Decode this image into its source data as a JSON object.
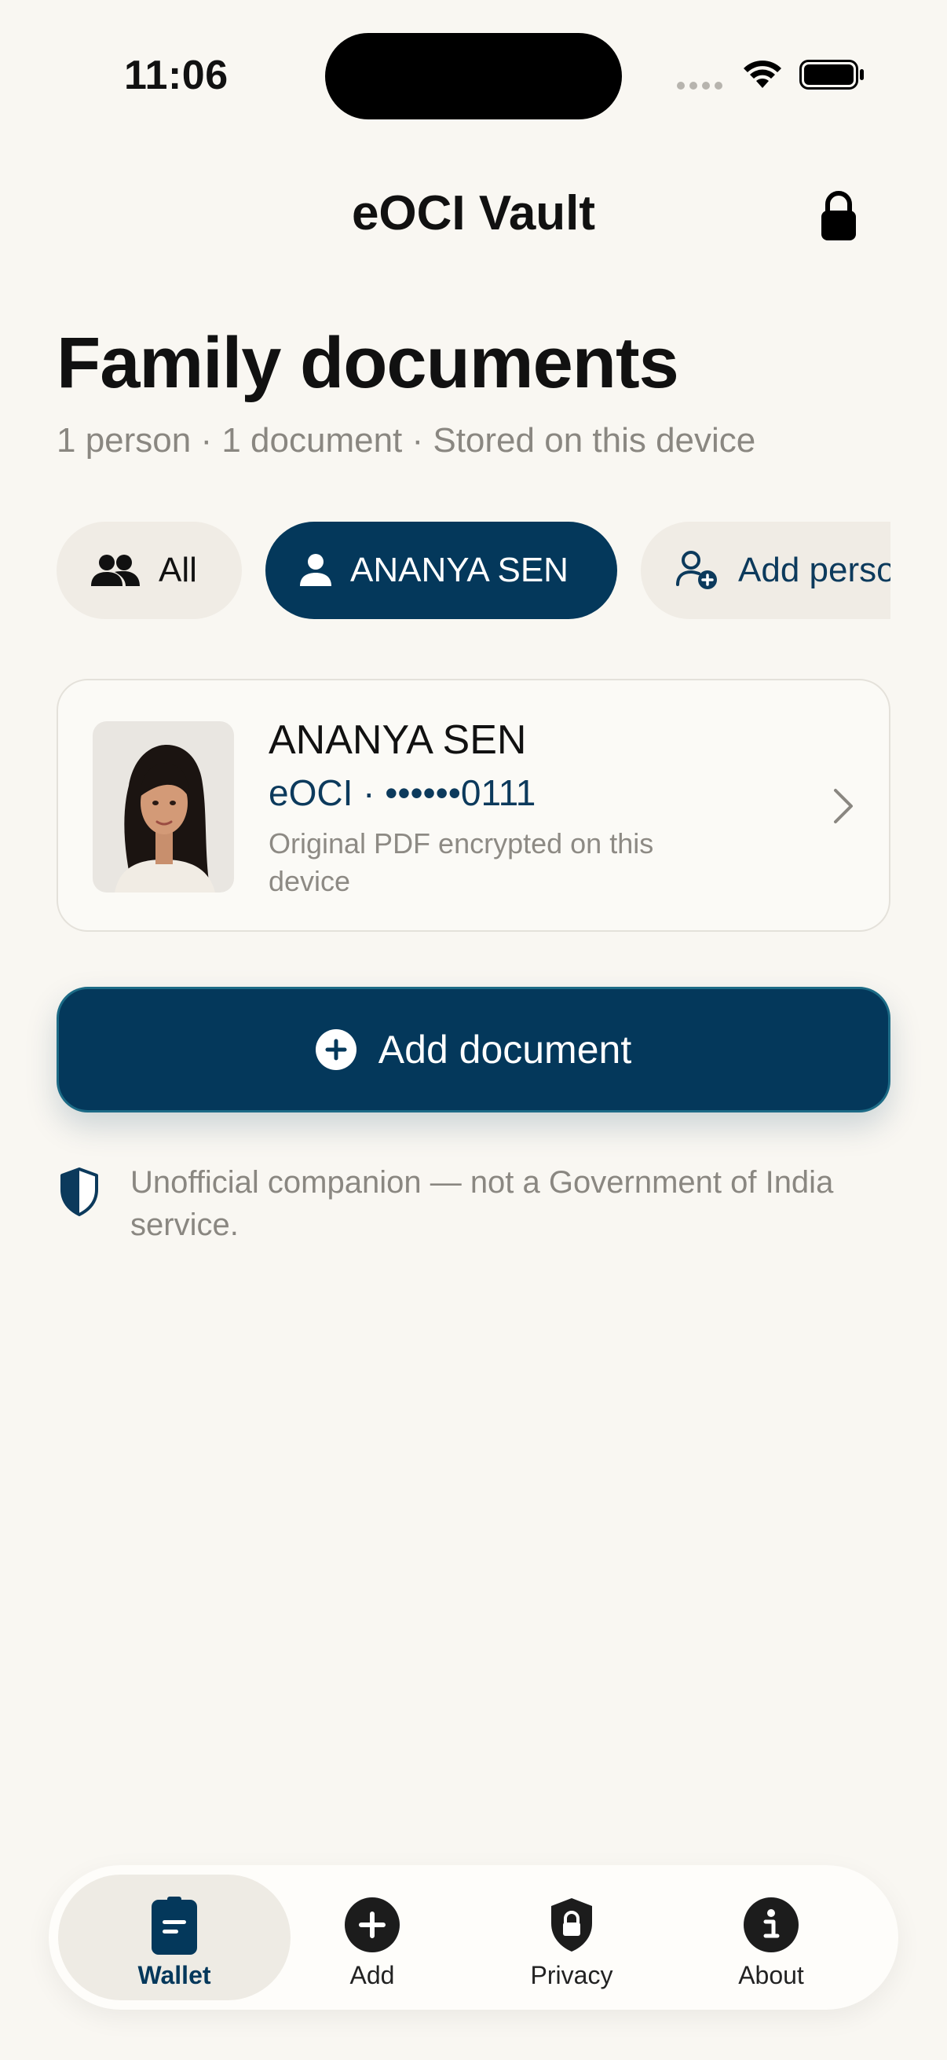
{
  "status_bar": {
    "time": "11:06"
  },
  "header": {
    "app_title": "eOCI Vault",
    "lock_icon": "lock-icon"
  },
  "page": {
    "title": "Family documents",
    "subtitle": "1 person · 1 document · Stored on this device"
  },
  "chips": [
    {
      "label": "All",
      "icon": "people-icon",
      "selected": false
    },
    {
      "label": "ANANYA SEN",
      "icon": "person-icon",
      "selected": true
    },
    {
      "label": "Add person",
      "icon": "person-add-icon",
      "selected": false
    }
  ],
  "document_card": {
    "name": "ANANYA SEN",
    "id_text": "eOCI · ••••••0111",
    "status_text": "Original PDF encrypted on this device"
  },
  "add_document": {
    "label": "Add document"
  },
  "disclaimer": {
    "text": "Unofficial companion — not a Government of India service."
  },
  "tab_bar": {
    "tabs": [
      {
        "label": "Wallet",
        "icon": "wallet-icon",
        "active": true
      },
      {
        "label": "Add",
        "icon": "add-circle-icon",
        "active": false
      },
      {
        "label": "Privacy",
        "icon": "shield-lock-icon",
        "active": false
      },
      {
        "label": "About",
        "icon": "info-icon",
        "active": false
      }
    ]
  },
  "colors": {
    "background": "#f9f7f2",
    "accent": "#04385b",
    "muted_text": "#8a8781"
  }
}
